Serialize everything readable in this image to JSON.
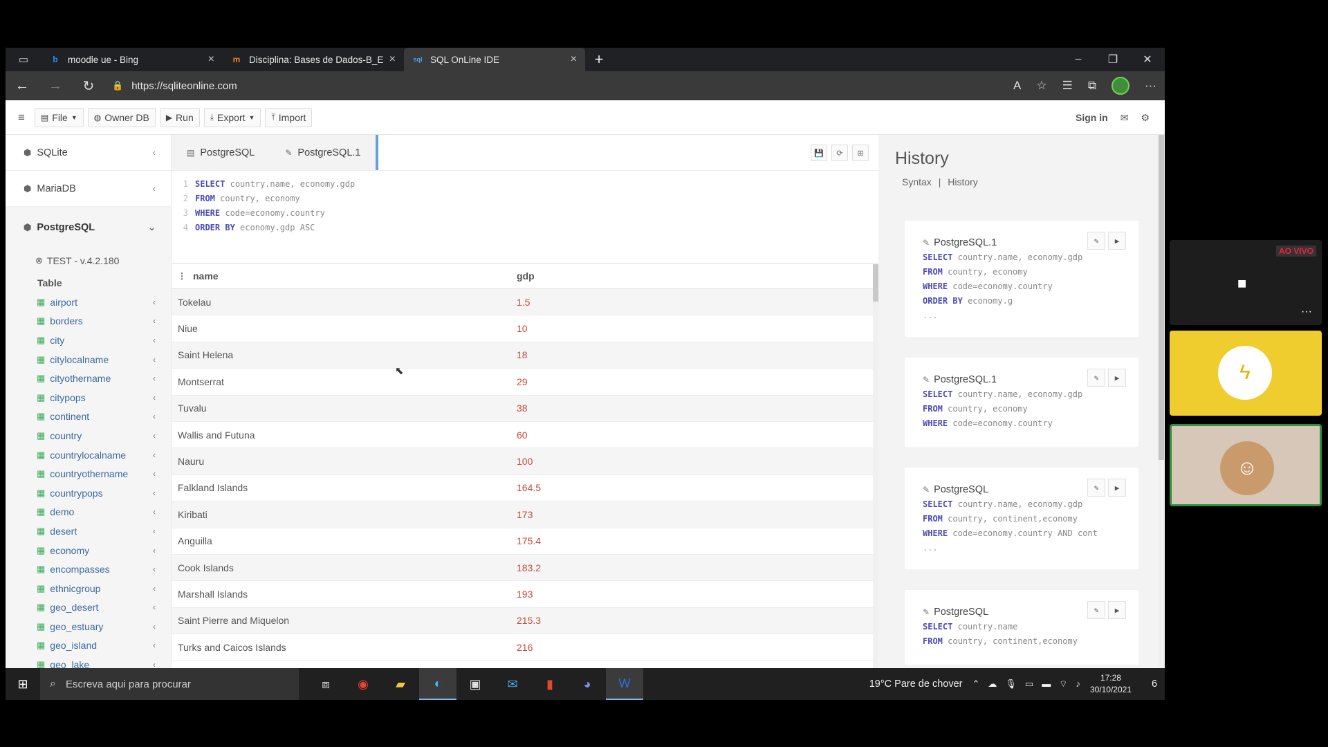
{
  "browser": {
    "tabs": [
      {
        "label": "moodle ue - Bing",
        "icon": "bing-icon",
        "active": false
      },
      {
        "label": "Disciplina: Bases de Dados-B_EIN",
        "icon": "moodle-icon",
        "active": false
      },
      {
        "label": "SQL OnLine IDE",
        "icon": "sqlonline-icon",
        "active": true
      }
    ],
    "url": "https://sqliteonline.com"
  },
  "toolbar": {
    "file": "File",
    "owner_db": "Owner DB",
    "run": "Run",
    "export": "Export",
    "import": "Import",
    "sign_in": "Sign in"
  },
  "sidebar": {
    "dbs": [
      {
        "label": "SQLite"
      },
      {
        "label": "MariaDB"
      },
      {
        "label": "PostgreSQL"
      }
    ],
    "connection": "TEST - v.4.2.180",
    "table_header": "Table",
    "tables": [
      "airport",
      "borders",
      "city",
      "citylocalname",
      "cityothername",
      "citypops",
      "continent",
      "country",
      "countrylocalname",
      "countryothername",
      "countrypops",
      "demo",
      "desert",
      "economy",
      "encompasses",
      "ethnicgroup",
      "geo_desert",
      "geo_estuary",
      "geo_island",
      "geo_lake"
    ]
  },
  "editor": {
    "tabs": [
      "PostgreSQL",
      "PostgreSQL.1"
    ],
    "lines": [
      {
        "n": "1",
        "kw": "SELECT",
        "rest": "country.name, economy.gdp"
      },
      {
        "n": "2",
        "kw": "FROM",
        "rest": "country, economy"
      },
      {
        "n": "3",
        "kw": "WHERE",
        "rest": "code=economy.country"
      },
      {
        "n": "4",
        "kw": "ORDER BY",
        "rest": "economy.gdp ASC"
      }
    ]
  },
  "results": {
    "columns": [
      "name",
      "gdp"
    ],
    "rows": [
      [
        "Tokelau",
        "1.5"
      ],
      [
        "Niue",
        "10"
      ],
      [
        "Saint Helena",
        "18"
      ],
      [
        "Montserrat",
        "29"
      ],
      [
        "Tuvalu",
        "38"
      ],
      [
        "Wallis and Futuna",
        "60"
      ],
      [
        "Nauru",
        "100"
      ],
      [
        "Falkland Islands",
        "164.5"
      ],
      [
        "Kiribati",
        "173"
      ],
      [
        "Anguilla",
        "175.4"
      ],
      [
        "Cook Islands",
        "183.2"
      ],
      [
        "Marshall Islands",
        "193"
      ],
      [
        "Saint Pierre and Miquelon",
        "215.3"
      ],
      [
        "Turks and Caicos Islands",
        "216"
      ]
    ]
  },
  "history": {
    "title": "History",
    "syntax_link": "Syntax",
    "separator": "|",
    "history_link": "History",
    "items": [
      {
        "name": "PostgreSQL.1",
        "lines": [
          [
            "SELECT",
            "country.name, economy.gdp"
          ],
          [
            "FROM",
            "country, economy"
          ],
          [
            "WHERE",
            "code=economy.country"
          ],
          [
            "ORDER BY",
            "economy.g"
          ]
        ],
        "more": "..."
      },
      {
        "name": "PostgreSQL.1",
        "lines": [
          [
            "SELECT",
            "country.name, economy.gdp"
          ],
          [
            "FROM",
            "country, economy"
          ],
          [
            "WHERE",
            "code=economy.country"
          ]
        ],
        "more": ""
      },
      {
        "name": "PostgreSQL",
        "lines": [
          [
            "SELECT",
            "country.name, economy.gdp"
          ],
          [
            "FROM",
            "country, continent,economy"
          ],
          [
            "WHERE",
            "code=economy.country AND cont"
          ]
        ],
        "more": "..."
      },
      {
        "name": "PostgreSQL",
        "lines": [
          [
            "SELECT",
            "country.name"
          ],
          [
            "FROM",
            "country, continent,economy"
          ]
        ],
        "more": ""
      }
    ]
  },
  "taskbar": {
    "search_placeholder": "Escreva aqui para procurar",
    "weather": "19°C  Pare de chover",
    "time": "17:28",
    "date": "30/10/2021",
    "notifications": "6"
  },
  "video": {
    "live_label": "AO VIVO"
  }
}
